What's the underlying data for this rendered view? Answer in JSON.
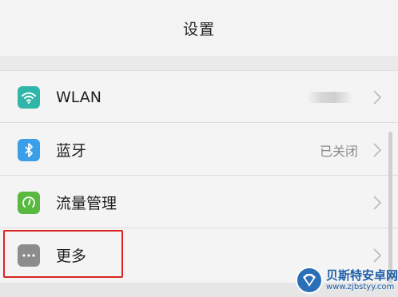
{
  "header": {
    "title": "设置"
  },
  "rows": [
    {
      "label": "WLAN",
      "value": "",
      "icon": "wifi-icon",
      "color": "#2fb6a8"
    },
    {
      "label": "蓝牙",
      "value": "已关闭",
      "icon": "bluetooth-icon",
      "color": "#3b9ee8"
    },
    {
      "label": "流量管理",
      "value": "",
      "icon": "data-usage-icon",
      "color": "#58b83f"
    },
    {
      "label": "更多",
      "value": "",
      "icon": "more-icon",
      "color": "#8c8c8c"
    }
  ],
  "highlight": {
    "color": "#d9241f"
  },
  "watermark": {
    "name": "贝斯特安卓网",
    "url": "www.zjbstyy.com"
  }
}
